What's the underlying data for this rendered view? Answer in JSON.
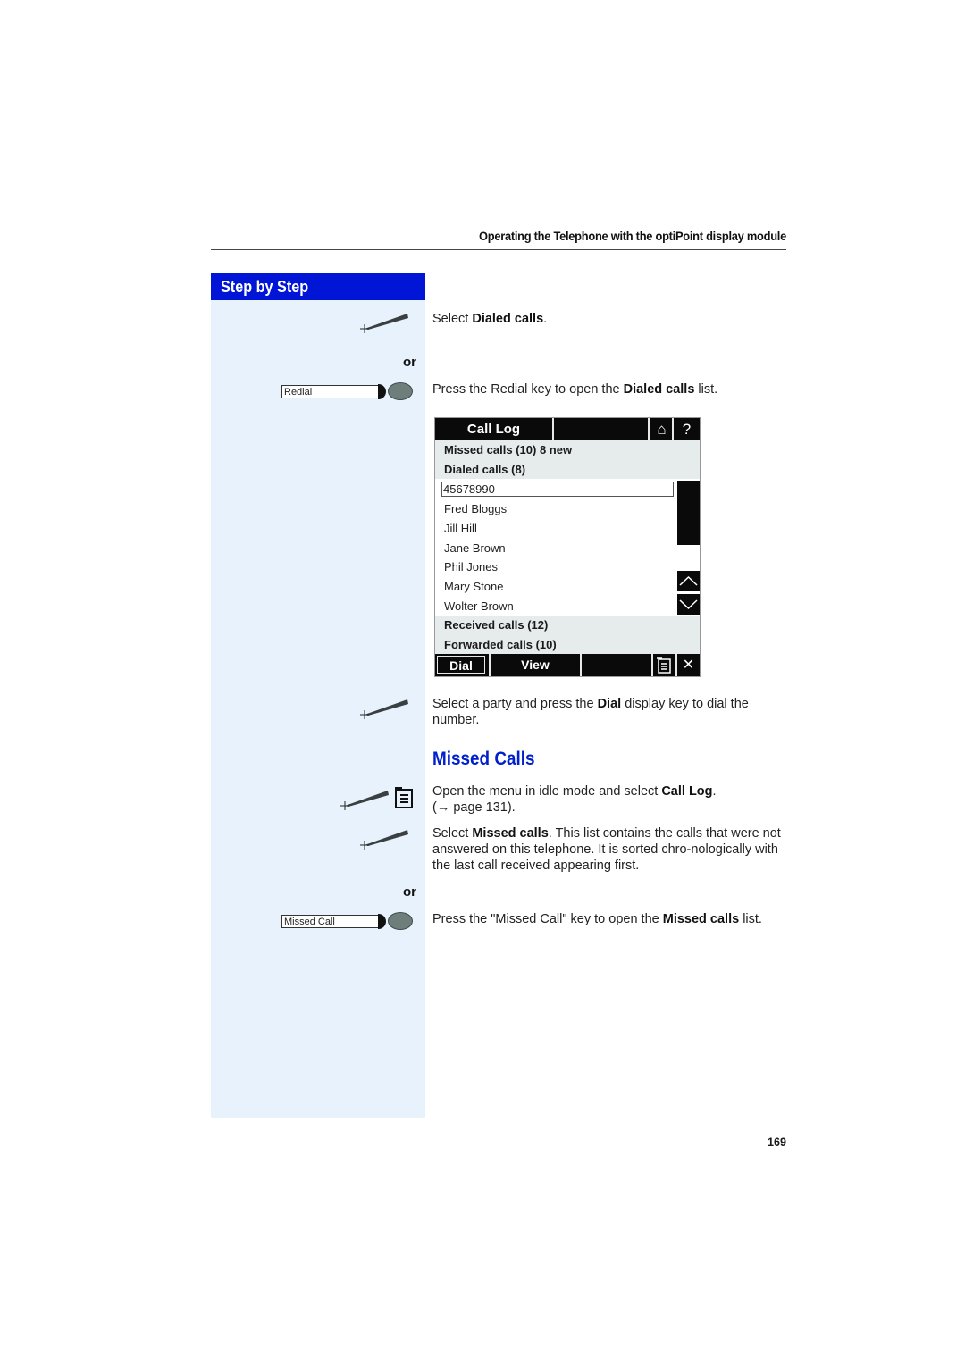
{
  "header": {
    "title": "Operating the Telephone with the optiPoint display module"
  },
  "sidebar": {
    "title": "Step by Step",
    "or_label": "or",
    "redial_key_label": "Redial",
    "missed_call_key_label": "Missed Call"
  },
  "steps": {
    "select_dialed": {
      "prefix": "Select ",
      "bold": "Dialed calls",
      "suffix": "."
    },
    "press_redial": {
      "prefix": "Press the Redial key to open the ",
      "bold": "Dialed calls",
      "suffix": " list."
    },
    "select_party": {
      "prefix": "Select a party and press the ",
      "bold": "Dial",
      "suffix": " display key to dial the number."
    },
    "open_menu": {
      "prefix": "Open the menu in idle mode and select ",
      "bold": "Call Log",
      "suffix": ".(→ page 131)."
    },
    "select_missed": {
      "prefix": "Select ",
      "bold": "Missed calls",
      "suffix": ". This list contains the calls that were not answered on this telephone. It is sorted chro-nologically with the last call received appearing first."
    },
    "press_missed": {
      "prefix": "Press the \"Missed Call\" key to open the ",
      "bold": "Missed calls",
      "suffix": " list."
    }
  },
  "section_title": "Missed Calls",
  "display": {
    "title": "Call Log",
    "home_icon": "⌂",
    "help_icon": "?",
    "categories_top": [
      "Missed calls (10) 8 new",
      "Dialed calls (8)"
    ],
    "entries": [
      "45678990",
      "Fred Bloggs",
      "Jill Hill",
      "Jane Brown",
      "Phil Jones",
      "Mary Stone",
      "Wolter Brown"
    ],
    "selected_index": 0,
    "categories_bottom": [
      "Received calls (12)",
      "Forwarded calls (10)"
    ],
    "softkeys": {
      "dial": "Dial",
      "view": "View"
    },
    "close_icon": "✕"
  },
  "page_number": "169",
  "colors": {
    "accent_blue": "#0015d6",
    "sidebar_bg": "#e8f2fc",
    "title_blue": "#0020cc"
  }
}
